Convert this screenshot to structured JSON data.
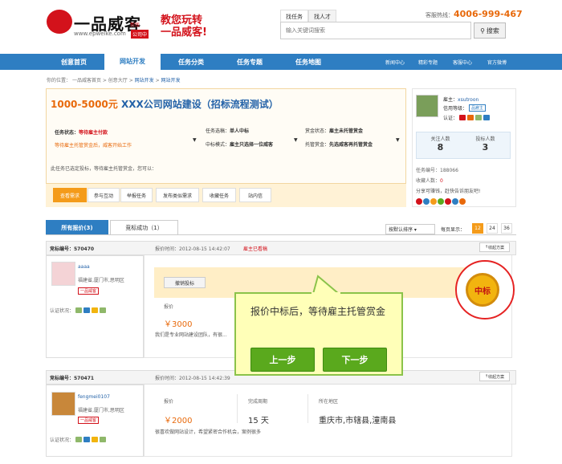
{
  "header": {
    "logo_text": "一品威客",
    "logo_url": "www.epweike.com",
    "logo_badge": "公司中",
    "logo_sub": "新版",
    "slogan_line1": "教您玩转",
    "slogan_line2": "一品威客!",
    "search_tabs": [
      "找任务",
      "找人才"
    ],
    "search_placeholder": "输入关键词搜索",
    "search_button": "搜索",
    "hotline_label": "客服热线：",
    "hotline_number": "4006-999-467"
  },
  "nav": {
    "items": [
      "创意首页",
      "网站开发",
      "任务分类",
      "任务专题",
      "任务地图"
    ],
    "active": "网站开发",
    "right_items": [
      "新闻中心",
      "精彩专题",
      "客服中心",
      "官方微博"
    ]
  },
  "breadcrumb": {
    "prefix": "你的位置：",
    "items": [
      "一品威客首页",
      "创意大厅",
      "网站开发",
      "网站开发"
    ]
  },
  "task": {
    "money": "1000-5000元",
    "title": "XXX公司网站建设（招标流程测试）",
    "status_label": "任务状态：",
    "status_value": "等待雇主付款",
    "status_note": "等待雇主托管赏金后，威客开始工作",
    "bid_label": "任务选稿：",
    "bid_value": "单人中标",
    "mode_label": "中标模式：",
    "mode_value": "雇主只选择一位威客",
    "reward_label": "赏金状态：",
    "reward_value": "雇主未托管赏金",
    "escrow_label": "托管赏金：",
    "escrow_value": "先选威客再托管赏金",
    "notice": "此任务已选定投标，等待雇主托管赏金，您可以：",
    "tabs": [
      "查看需求",
      "参与互动",
      "举报任务",
      "发布类似需求",
      "收藏任务",
      "站内信"
    ]
  },
  "employer": {
    "owner_label": "雇主：",
    "owner_name": "xsutroon",
    "credit_label": "信用等级：",
    "credit_badge": "品雇主",
    "auth_label": "认证：",
    "follow_label": "关注人数",
    "follow_value": "8",
    "bid_label": "投标人数",
    "bid_value": "3",
    "task_no_label": "任务编号：",
    "task_no": "188066",
    "fav_label": "收藏人数：",
    "fav_value": "0",
    "share_text": "分享可赚钱，赶快告诉朋友吧!"
  },
  "bids": {
    "tabs": [
      "所有报价(3)",
      "竞标成功（1）"
    ],
    "sort_label": "按默认排序",
    "page_label": "每页显示：",
    "page_sizes": [
      "12",
      "24",
      "36"
    ],
    "cards": [
      {
        "no_label": "竞标编号：570470",
        "user": "aaaa",
        "location": "福建省,厦门市,思明区",
        "level": "一品威客",
        "auth_label": "认证状况：",
        "time": "报价时间：2012-08-15 14:42:07",
        "status": "雇主已看稿",
        "fold": "收起方案",
        "cancel": "撤销投标",
        "price_label": "报价",
        "price": "￥3000",
        "desc": "我们是专业网站建设团队，有很..."
      },
      {
        "no_label": "竞标编号：570471",
        "user": "fengmei0107",
        "location": "福建省,厦门市,思明区",
        "level": "一品威客",
        "auth_label": "认证状况：",
        "time": "报价时间：2012-08-15 14:42:39",
        "fold": "收起方案",
        "price_label": "报价",
        "price": "￥2000",
        "period_label": "完成周期",
        "period": "15 天",
        "region_label": "所在地区",
        "region": "重庆市,市辖县,潼南县",
        "desc": "很喜欢做网站设计，希望紧密合作机会，案例很多"
      }
    ]
  },
  "tooltip": {
    "text": "报价中标后，等待雇主托管赏金",
    "prev": "上一步",
    "next": "下一步"
  },
  "medal": {
    "label": "中标"
  },
  "colors": {
    "nav_blue": "#2e7ec2",
    "brand_red": "#d3121b",
    "orange": "#e8690b",
    "green_btn": "#5aa91d"
  }
}
